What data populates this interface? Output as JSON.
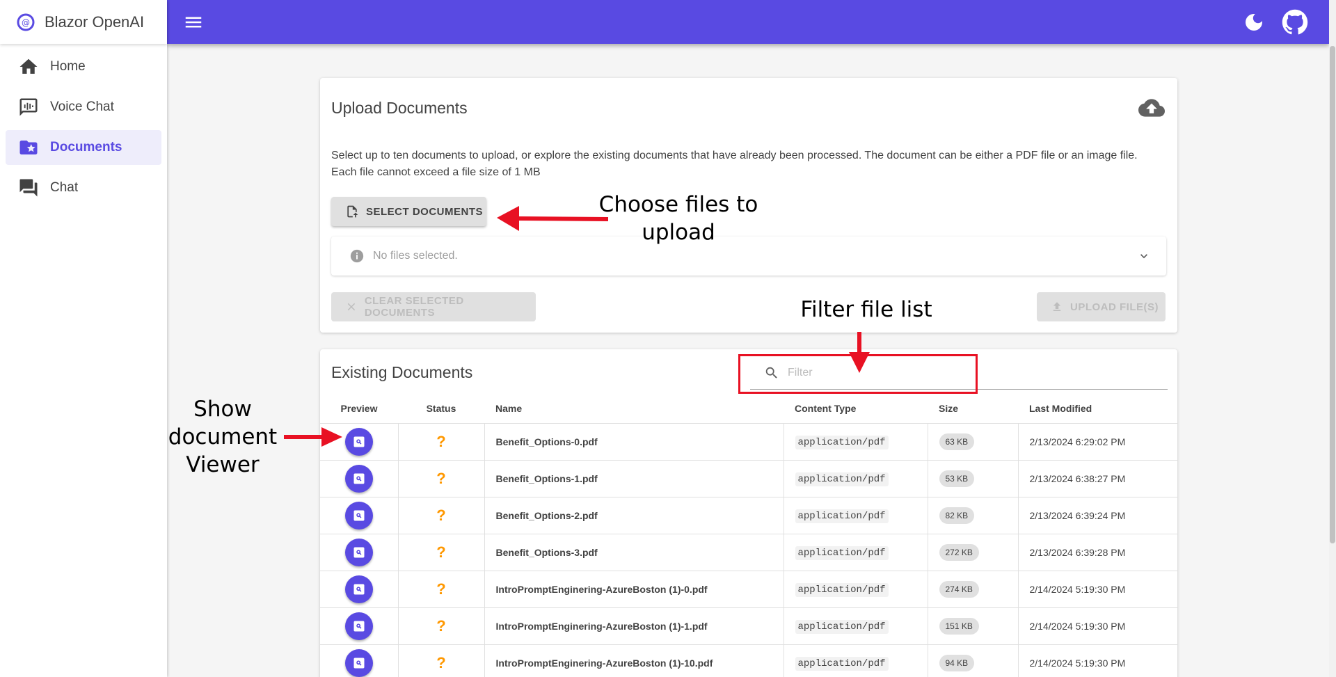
{
  "app": {
    "brand": "Blazor OpenAI"
  },
  "sidebar": {
    "items": [
      {
        "label": "Home",
        "icon": "home-icon"
      },
      {
        "label": "Voice Chat",
        "icon": "voice-chat-icon"
      },
      {
        "label": "Documents",
        "icon": "folder-star-icon",
        "active": true
      },
      {
        "label": "Chat",
        "icon": "chat-icon"
      }
    ]
  },
  "appbar": {
    "menu_icon": "hamburger-menu-icon",
    "theme_icon": "moon-icon",
    "github_icon": "github-icon"
  },
  "upload": {
    "title": "Upload Documents",
    "description_line1": "Select up to ten documents to upload, or explore the existing documents that have already been processed. The document can be either a PDF file or an image file.",
    "description_line2": "Each file cannot exceed a file size of 1 MB",
    "select_button": "SELECT DOCUMENTS",
    "no_files": "No files selected.",
    "clear_button": "CLEAR SELECTED DOCUMENTS",
    "upload_button": "UPLOAD FILE(S)"
  },
  "existing": {
    "title": "Existing Documents",
    "filter_placeholder": "Filter",
    "columns": [
      "Preview",
      "Status",
      "Name",
      "Content Type",
      "Size",
      "Last Modified"
    ],
    "rows": [
      {
        "status": "?",
        "name": "Benefit_Options-0.pdf",
        "type": "application/pdf",
        "size": "63 KB",
        "modified": "2/13/2024 6:29:02 PM"
      },
      {
        "status": "?",
        "name": "Benefit_Options-1.pdf",
        "type": "application/pdf",
        "size": "53 KB",
        "modified": "2/13/2024 6:38:27 PM"
      },
      {
        "status": "?",
        "name": "Benefit_Options-2.pdf",
        "type": "application/pdf",
        "size": "82 KB",
        "modified": "2/13/2024 6:39:24 PM"
      },
      {
        "status": "?",
        "name": "Benefit_Options-3.pdf",
        "type": "application/pdf",
        "size": "272 KB",
        "modified": "2/13/2024 6:39:28 PM"
      },
      {
        "status": "?",
        "name": "IntroPromptEnginering-AzureBoston (1)-0.pdf",
        "type": "application/pdf",
        "size": "274 KB",
        "modified": "2/14/2024 5:19:30 PM"
      },
      {
        "status": "?",
        "name": "IntroPromptEnginering-AzureBoston (1)-1.pdf",
        "type": "application/pdf",
        "size": "151 KB",
        "modified": "2/14/2024 5:19:30 PM"
      },
      {
        "status": "?",
        "name": "IntroPromptEnginering-AzureBoston (1)-10.pdf",
        "type": "application/pdf",
        "size": "94 KB",
        "modified": "2/14/2024 5:19:30 PM"
      }
    ]
  },
  "annotations": {
    "choose_line1": "Choose files to",
    "choose_line2": "upload",
    "filter_label": "Filter file list",
    "show_line1": "Show",
    "show_line2": "document",
    "show_line3": "Viewer"
  },
  "colors": {
    "primary": "#594ae2",
    "annotation_red": "#e81123",
    "status_warning": "#ff9800"
  }
}
